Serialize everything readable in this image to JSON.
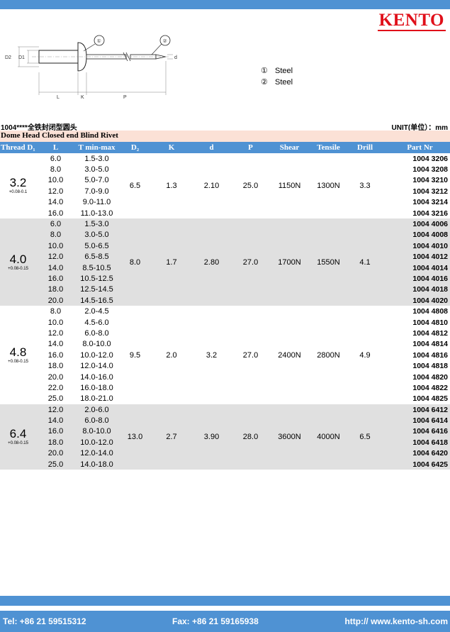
{
  "brand": {
    "logo": "KENTO"
  },
  "drawing": {
    "dimension_labels": [
      "D2",
      "D1",
      "L",
      "K",
      "P",
      "d"
    ],
    "callouts": [
      "①",
      "②"
    ]
  },
  "materials": [
    {
      "num": "①",
      "name": "Steel"
    },
    {
      "num": "②",
      "name": "Steel"
    }
  ],
  "series_code": "1004****全铁封闭型圆头",
  "unit_label": "UNIT(单位）：mm",
  "product_title": "Dome Head Closed end Blind Rivet",
  "table": {
    "headers": [
      "Thread D₁",
      "L",
      "T min-max",
      "D₂",
      "K",
      "d",
      "P",
      "Shear",
      "Tensile",
      "Drill",
      "Part Nr"
    ],
    "groups": [
      {
        "thread": "3.2",
        "tolerance": "+0.08-0.1",
        "D2": "6.5",
        "K": "1.3",
        "d": "2.10",
        "P": "25.0",
        "shear": "1150N",
        "tensile": "1300N",
        "drill": "3.3",
        "shade": "white",
        "rows": [
          {
            "L": "6.0",
            "T": "1.5-3.0",
            "part": "1004 3206"
          },
          {
            "L": "8.0",
            "T": "3.0-5.0",
            "part": "1004 3208"
          },
          {
            "L": "10.0",
            "T": "5.0-7.0",
            "part": "1004 3210"
          },
          {
            "L": "12.0",
            "T": "7.0-9.0",
            "part": "1004 3212"
          },
          {
            "L": "14.0",
            "T": "9.0-11.0",
            "part": "1004 3214"
          },
          {
            "L": "16.0",
            "T": "11.0-13.0",
            "part": "1004 3216"
          }
        ]
      },
      {
        "thread": "4.0",
        "tolerance": "+0.08-0.15",
        "D2": "8.0",
        "K": "1.7",
        "d": "2.80",
        "P": "27.0",
        "shear": "1700N",
        "tensile": "1550N",
        "drill": "4.1",
        "shade": "gray",
        "rows": [
          {
            "L": "6.0",
            "T": "1.5-3.0",
            "part": "1004 4006"
          },
          {
            "L": "8.0",
            "T": "3.0-5.0",
            "part": "1004 4008"
          },
          {
            "L": "10.0",
            "T": "5.0-6.5",
            "part": "1004 4010"
          },
          {
            "L": "12.0",
            "T": "6.5-8.5",
            "part": "1004 4012"
          },
          {
            "L": "14.0",
            "T": "8.5-10.5",
            "part": "1004 4014"
          },
          {
            "L": "16.0",
            "T": "10.5-12.5",
            "part": "1004 4016"
          },
          {
            "L": "18.0",
            "T": "12.5-14.5",
            "part": "1004 4018"
          },
          {
            "L": "20.0",
            "T": "14.5-16.5",
            "part": "1004 4020"
          }
        ]
      },
      {
        "thread": "4.8",
        "tolerance": "+0.08-0.15",
        "D2": "9.5",
        "K": "2.0",
        "d": "3.2",
        "P": "27.0",
        "shear": "2400N",
        "tensile": "2800N",
        "drill": "4.9",
        "shade": "white",
        "rows": [
          {
            "L": "8.0",
            "T": "2.0-4.5",
            "part": "1004 4808"
          },
          {
            "L": "10.0",
            "T": "4.5-6.0",
            "part": "1004 4810"
          },
          {
            "L": "12.0",
            "T": "6.0-8.0",
            "part": "1004 4812"
          },
          {
            "L": "14.0",
            "T": "8.0-10.0",
            "part": "1004 4814"
          },
          {
            "L": "16.0",
            "T": "10.0-12.0",
            "part": "1004 4816"
          },
          {
            "L": "18.0",
            "T": "12.0-14.0",
            "part": "1004 4818"
          },
          {
            "L": "20.0",
            "T": "14.0-16.0",
            "part": "1004 4820"
          },
          {
            "L": "22.0",
            "T": "16.0-18.0",
            "part": "1004 4822"
          },
          {
            "L": "25.0",
            "T": "18.0-21.0",
            "part": "1004 4825"
          }
        ]
      },
      {
        "thread": "6.4",
        "tolerance": "+0.08-0.15",
        "D2": "13.0",
        "K": "2.7",
        "d": "3.90",
        "P": "28.0",
        "shear": "3600N",
        "tensile": "4000N",
        "drill": "6.5",
        "shade": "gray",
        "rows": [
          {
            "L": "12.0",
            "T": "2.0-6.0",
            "part": "1004 6412"
          },
          {
            "L": "14.0",
            "T": "6.0-8.0",
            "part": "1004 6414"
          },
          {
            "L": "16.0",
            "T": "8.0-10.0",
            "part": "1004 6416"
          },
          {
            "L": "18.0",
            "T": "10.0-12.0",
            "part": "1004 6418"
          },
          {
            "L": "20.0",
            "T": "12.0-14.0",
            "part": "1004 6420"
          },
          {
            "L": "25.0",
            "T": "14.0-18.0",
            "part": "1004 6425"
          }
        ]
      }
    ]
  },
  "footer": {
    "tel": "Tel: +86 21 59515312",
    "fax": "Fax: +86 21 59165938",
    "website": "http:// www.kento-sh.com"
  },
  "colors": {
    "accent_blue": "#4f92d3",
    "brand_red": "#e0101a",
    "title_strip": "#fbe1d6",
    "row_gray": "#e0e0e0"
  }
}
